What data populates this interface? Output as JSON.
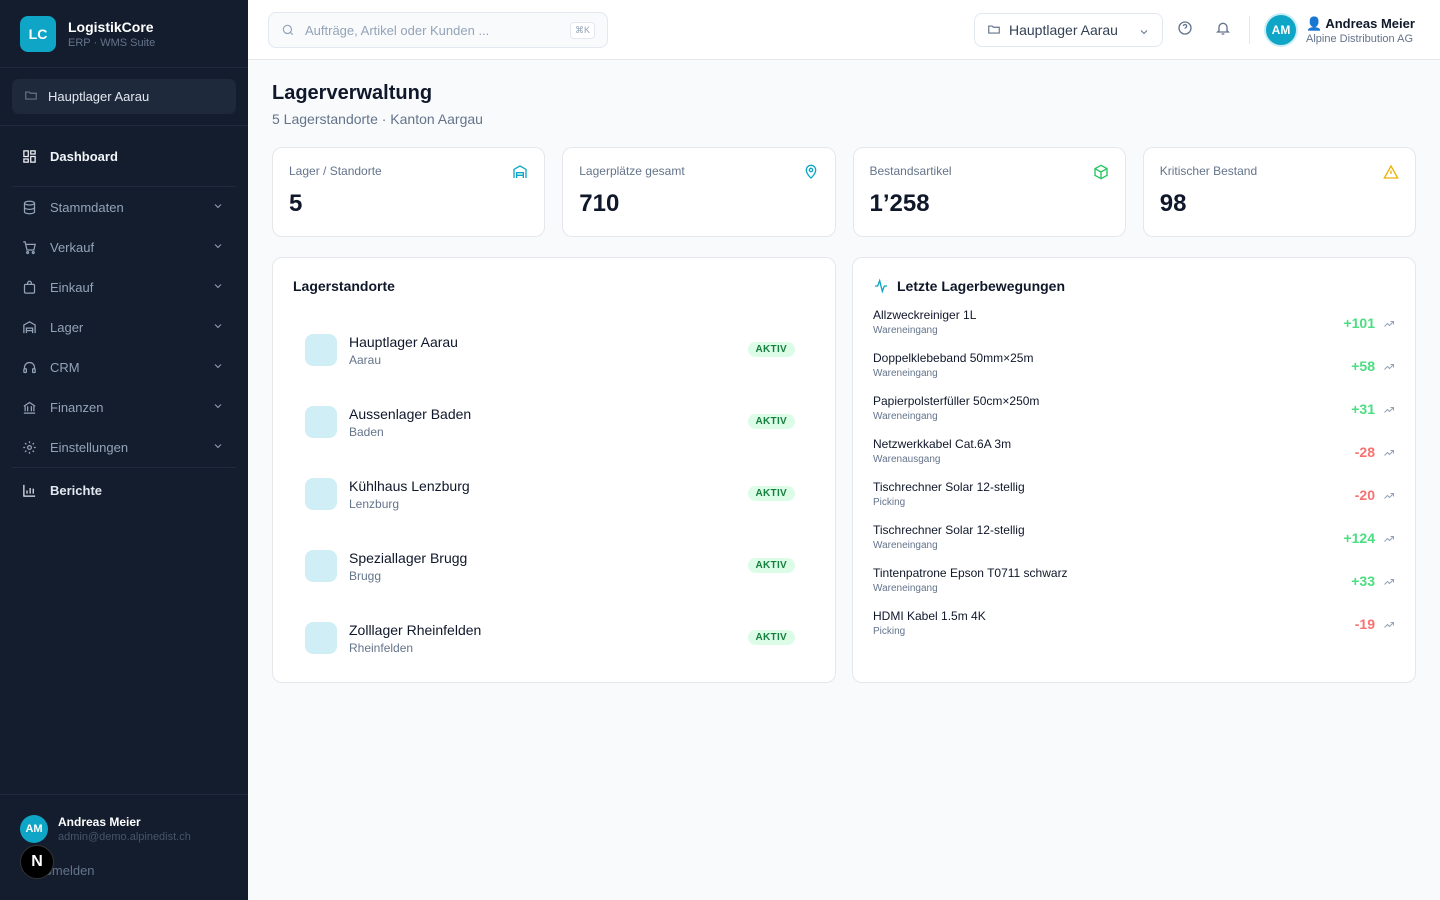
{
  "brand": {
    "logo": "LC",
    "name": "LogistikCore",
    "subtitle": "ERP · WMS Suite"
  },
  "sidebar": {
    "location": "Hauptlager Aarau",
    "nav": [
      {
        "label": "Dashboard",
        "icon": "grid-icon",
        "active": true
      },
      {
        "label": "Stammdaten",
        "icon": "database-icon"
      },
      {
        "label": "Verkauf",
        "icon": "cart-icon"
      },
      {
        "label": "Einkauf",
        "icon": "bag-icon"
      },
      {
        "label": "Lager",
        "icon": "warehouse-icon"
      },
      {
        "label": "CRM",
        "icon": "headset-icon"
      },
      {
        "label": "Finanzen",
        "icon": "bank-icon"
      },
      {
        "label": "Einstellungen",
        "icon": "gear-icon"
      },
      {
        "label": "Berichte",
        "icon": "chart-icon"
      }
    ],
    "user": {
      "initials": "AM",
      "name": "Andreas Meier",
      "email": "admin@demo.alpinedist.ch"
    },
    "logout": "Abmelden",
    "n_badge": "N"
  },
  "topbar": {
    "search_placeholder": "Aufträge, Artikel oder Kunden ...",
    "shortcut": "⌘K",
    "location": "Hauptlager Aarau",
    "user": {
      "initials": "AM",
      "name": "Andreas Meier",
      "company": "Alpine Distribution AG"
    }
  },
  "page": {
    "title": "Lagerverwaltung",
    "subtitle": "5 Lagerstandorte · Kanton Aargau"
  },
  "stats": [
    {
      "label": "Lager / Standorte",
      "value": "5",
      "icon": "warehouse-icon",
      "color": "#0ea5c6"
    },
    {
      "label": "Lagerplätze gesamt",
      "value": "710",
      "icon": "map-pin-icon",
      "color": "#0ea5c6"
    },
    {
      "label": "Bestandsartikel",
      "value": "1’258",
      "icon": "package-icon",
      "color": "#22c55e"
    },
    {
      "label": "Kritischer Bestand",
      "value": "98",
      "icon": "warning-icon",
      "color": "#eab308"
    }
  ],
  "locations": {
    "title": "Lagerstandorte",
    "items": [
      {
        "name": "Hauptlager Aarau",
        "city": "Aarau",
        "status": "AKTIV"
      },
      {
        "name": "Aussenlager Baden",
        "city": "Baden",
        "status": "AKTIV"
      },
      {
        "name": "Kühlhaus Lenzburg",
        "city": "Lenzburg",
        "status": "AKTIV"
      },
      {
        "name": "Speziallager Brugg",
        "city": "Brugg",
        "status": "AKTIV"
      },
      {
        "name": "Zolllager Rheinfelden",
        "city": "Rheinfelden",
        "status": "AKTIV"
      }
    ]
  },
  "movements": {
    "title": "Letzte Lagerbewegungen",
    "items": [
      {
        "name": "Allzweckreiniger 1L",
        "type": "Wareneingang",
        "qty": "+101",
        "dir": "pos"
      },
      {
        "name": "Doppelklebeband 50mm×25m",
        "type": "Wareneingang",
        "qty": "+58",
        "dir": "pos"
      },
      {
        "name": "Papierpolsterfüller 50cm×250m",
        "type": "Wareneingang",
        "qty": "+31",
        "dir": "pos"
      },
      {
        "name": "Netzwerkkabel Cat.6A 3m",
        "type": "Warenausgang",
        "qty": "-28",
        "dir": "neg"
      },
      {
        "name": "Tischrechner Solar 12-stellig",
        "type": "Picking",
        "qty": "-20",
        "dir": "neg"
      },
      {
        "name": "Tischrechner Solar 12-stellig",
        "type": "Wareneingang",
        "qty": "+124",
        "dir": "pos"
      },
      {
        "name": "Tintenpatrone Epson T0711 schwarz",
        "type": "Wareneingang",
        "qty": "+33",
        "dir": "pos"
      },
      {
        "name": "HDMI Kabel 1.5m 4K",
        "type": "Picking",
        "qty": "-19",
        "dir": "neg"
      }
    ]
  }
}
